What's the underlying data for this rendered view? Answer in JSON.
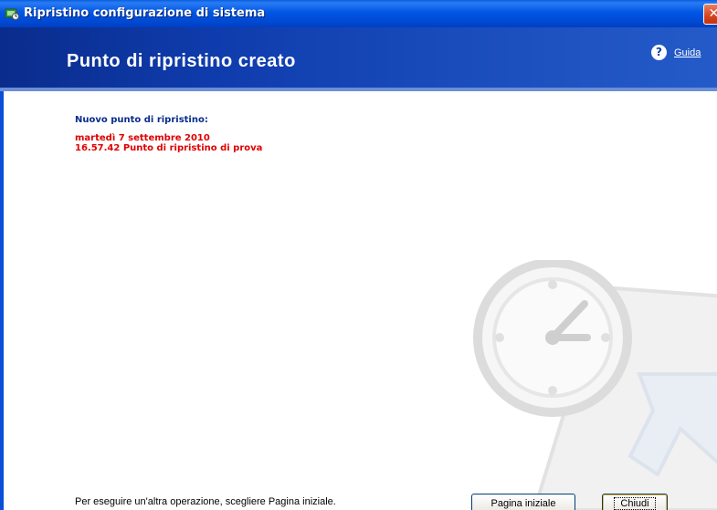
{
  "window": {
    "title": "Ripristino configurazione di sistema",
    "close_icon": "close-icon",
    "app_icon": "system-restore-icon"
  },
  "header": {
    "title": "Punto di ripristino creato",
    "help_label": "Guida",
    "help_icon": "help-icon"
  },
  "restore_point": {
    "heading": "Nuovo punto di ripristino:",
    "date": "martedì 7 settembre 2010",
    "details": "16.57.42  Punto di ripristino di prova"
  },
  "footer": {
    "instruction": "Per eseguire un'altra operazione, scegliere Pagina iniziale.",
    "home_button": "Pagina iniziale",
    "close_button": "Chiudi"
  },
  "colors": {
    "header_bg": "#0f3cad",
    "heading_text": "#0a2c8c",
    "restore_point_text": "#e00000"
  }
}
